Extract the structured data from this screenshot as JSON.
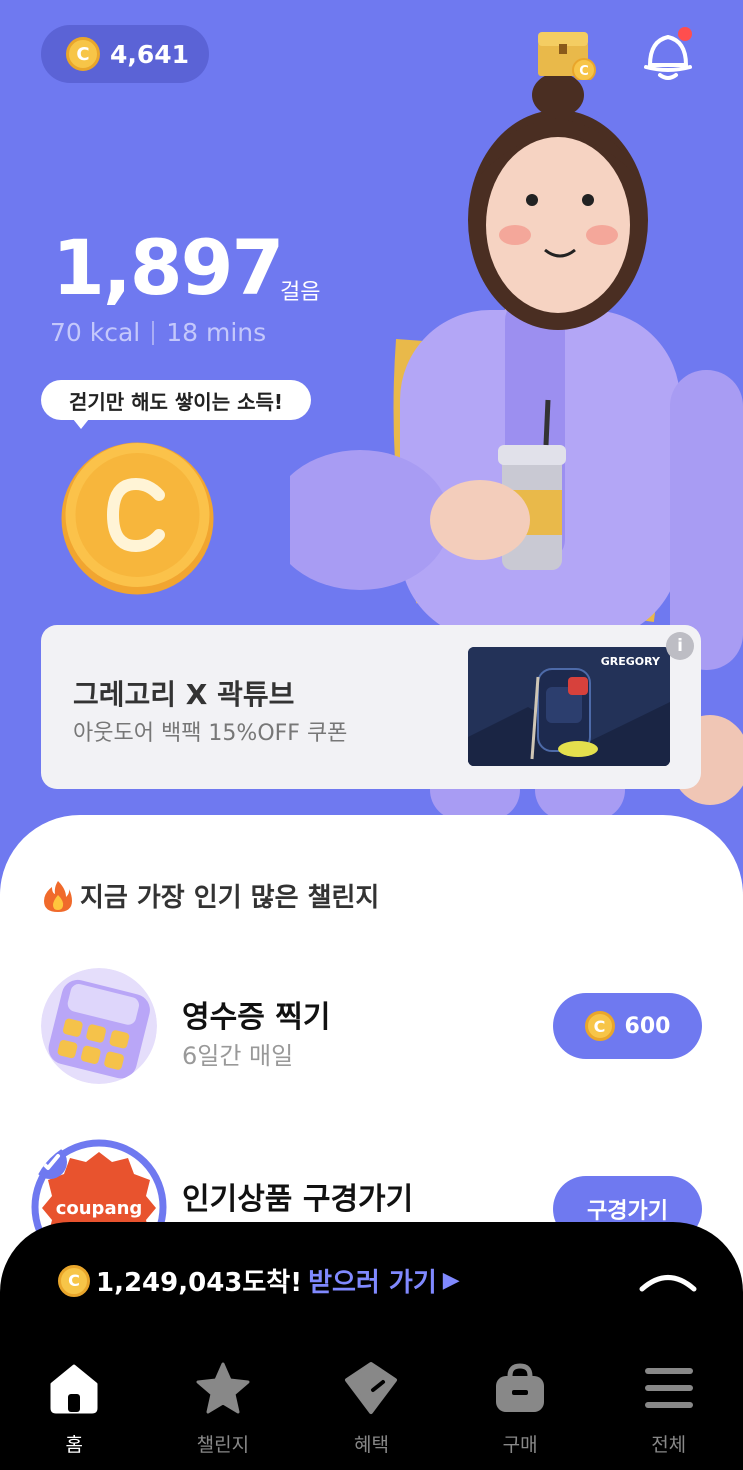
{
  "header": {
    "point_balance": "4,641",
    "coin_letter": "C"
  },
  "steps": {
    "count": "1,897",
    "unit": "걸음",
    "kcal": "70 kcal",
    "mins": "18 mins"
  },
  "bubble": {
    "text": "걷기만 해도 쌓이는 소득!"
  },
  "ad": {
    "title": "그레고리 X 곽튜브",
    "subtitle": "아웃도어 백팩 15%OFF 쿠폰",
    "brand": "GREGORY"
  },
  "popular": {
    "title": "지금 가장 인기 많은 챌린지",
    "items": [
      {
        "name": "영수증 찍기",
        "sub": "6일간 매일",
        "button": "600"
      },
      {
        "name": "인기상품 구경가기",
        "sub": "",
        "button": "구경가기",
        "logo_text": "coupang"
      }
    ]
  },
  "promo": {
    "amount": "1,249,043도착!",
    "link": "받으러 가기"
  },
  "tabs": [
    {
      "label": "홈",
      "icon": "home-icon"
    },
    {
      "label": "챌린지",
      "icon": "star-icon"
    },
    {
      "label": "혜택",
      "icon": "tag-icon"
    },
    {
      "label": "구매",
      "icon": "bag-icon"
    },
    {
      "label": "전체",
      "icon": "menu-icon"
    }
  ],
  "colors": {
    "primary": "#6f79f0",
    "coin": "#f7c548",
    "link": "#8089ff"
  }
}
